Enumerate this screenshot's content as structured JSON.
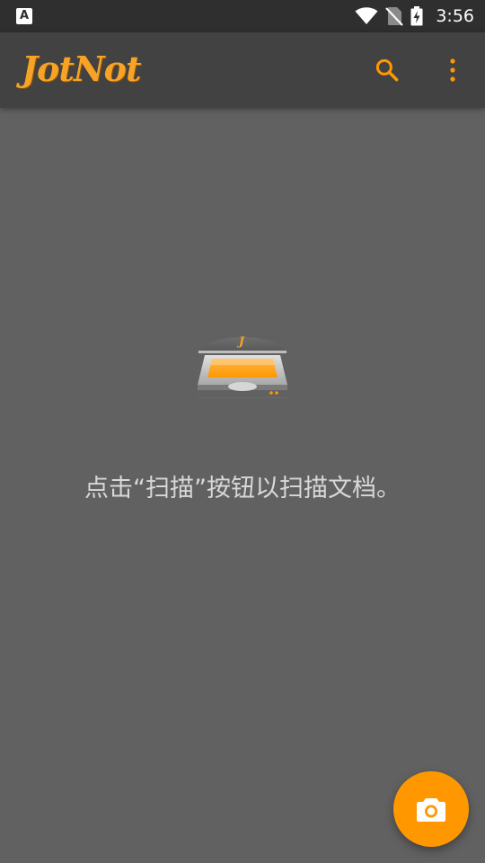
{
  "status_bar": {
    "notification_icon": "a-notification-icon",
    "notification_letter": "A",
    "time": "3:56",
    "icons": [
      "wifi-icon",
      "no-sim-icon",
      "battery-charging-icon"
    ]
  },
  "app_bar": {
    "logo_text": "JotNot",
    "actions": [
      "search-icon",
      "more-vert-icon"
    ]
  },
  "empty_state": {
    "illustration": "scanner-icon",
    "message": "点击“扫描”按钮以扫描文档。"
  },
  "fab": {
    "icon": "camera-icon"
  },
  "colors": {
    "accent": "#ff9800",
    "logo": "#f7a325",
    "app_bar": "#424242",
    "status_bar": "#2f2f2f",
    "background": "#616161",
    "message_text": "#d8d8d8"
  }
}
